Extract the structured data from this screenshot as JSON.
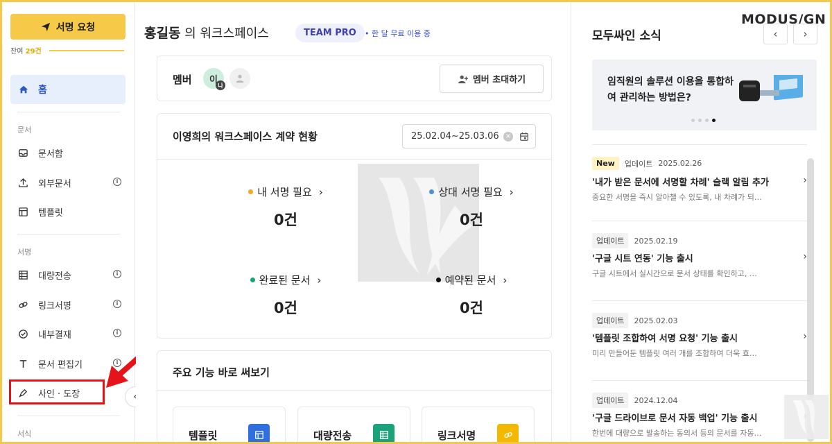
{
  "sidebar": {
    "sign_request_label": "서명 요청",
    "remaining_prefix": "잔여",
    "remaining_count": "29건",
    "home_label": "홈",
    "sections": {
      "documents": "문서",
      "signing": "서명",
      "forms": "서식"
    },
    "doc_items": [
      {
        "label": "문서함",
        "icon": "inbox-icon",
        "info": false
      },
      {
        "label": "외부문서",
        "icon": "upload-icon",
        "info": true
      },
      {
        "label": "템플릿",
        "icon": "template-icon",
        "info": false
      }
    ],
    "sign_items": [
      {
        "label": "대량전송",
        "icon": "table-icon",
        "info": true
      },
      {
        "label": "링크서명",
        "icon": "link-icon",
        "info": true
      },
      {
        "label": "내부결재",
        "icon": "check-circle-icon",
        "info": true
      },
      {
        "label": "문서 편집기",
        "icon": "text-icon",
        "info": true
      },
      {
        "label": "사인 · 도장",
        "icon": "pen-icon",
        "info": false
      }
    ],
    "info_glyph": "i",
    "collapse_glyph": "‹"
  },
  "main": {
    "workspace_owner": "홍길동",
    "workspace_suffix": " 의 워크스페이스",
    "plan_badge": "TEAM PRO",
    "trial_note": "• 한 달 무료 이용 중",
    "member_label": "멤버",
    "avatar_initial": "이",
    "avatar_mini": "나",
    "invite_label": "멤버 초대하기",
    "contract_title": "이영희의 워크스페이스 계약 현황",
    "date_range": "25.02.04~25.03.06",
    "stats": [
      {
        "label": "내 서명 필요",
        "value": "0건",
        "color": "#f5a623"
      },
      {
        "label": "상대 서명 필요",
        "value": "0건",
        "color": "#4a90e2"
      },
      {
        "label": "완료된 문서",
        "value": "0건",
        "color": "#1aa37a"
      },
      {
        "label": "예약된 문서",
        "value": "0건",
        "color": "#111111"
      }
    ],
    "features_title": "주요 기능 바로 써보기",
    "features": [
      {
        "label": "템플릿",
        "color": "#2f6fe0",
        "icon": "template-icon"
      },
      {
        "label": "대량전송",
        "color": "#1aa37a",
        "icon": "table-icon"
      },
      {
        "label": "링크서명",
        "color": "#f5b800",
        "icon": "link-icon"
      }
    ]
  },
  "right": {
    "logo": "MODUS/GN",
    "news_title": "모두싸인 소식",
    "prev_glyph": "‹",
    "next_glyph": "›",
    "banner_text": "임직원의 솔루션 이용을 통합하여 관리하는 방법은?",
    "news": [
      {
        "new": "New",
        "category": "업데이트",
        "date": "2025.02.26",
        "headline": "'내가 받은 문서에 서명할 차례' 슬랙 알림 추가",
        "summary": "중요한 서명을 즉시 알아챌 수 있도록, 내 차례가 되…"
      },
      {
        "new": "",
        "category": "업데이트",
        "date": "2025.02.19",
        "headline": "'구글 시트 연동' 기능 출시",
        "summary": "구글 시트에서 실시간으로 문서 상태를 확인하고, …"
      },
      {
        "new": "",
        "category": "업데이트",
        "date": "2025.02.03",
        "headline": "'템플릿 조합하여 서명 요청' 기능 출시",
        "summary": "미리 만들어둔 템플릿 여러 개를 조합하여 더욱 효…"
      },
      {
        "new": "",
        "category": "업데이트",
        "date": "2024.12.04",
        "headline": "'구글 드라이브로 문서 자동 백업' 기능 출시",
        "summary": "한번에 대량으로 발송하는 동의서 등의 문서를 자동…"
      }
    ],
    "chevron": "›"
  },
  "colors": {
    "accent_yellow": "#f7c948",
    "primary_blue": "#2b57c9",
    "highlight_red": "#e5141a"
  }
}
